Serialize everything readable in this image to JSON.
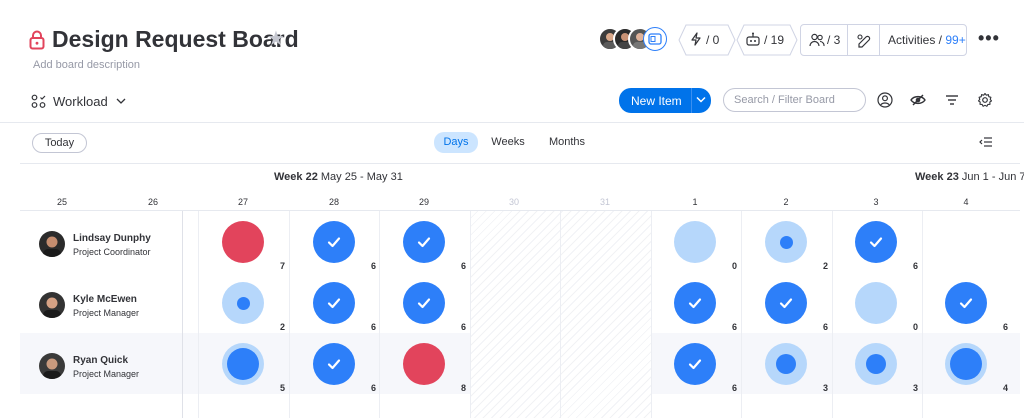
{
  "board": {
    "title": "Design Request Board",
    "description": "Add board description"
  },
  "header": {
    "updates_count": "/ 0",
    "robots_count": "/ 19",
    "members_count": "/ 3",
    "activities_label": "Activities /",
    "activities_count": "99+",
    "icons": [
      "lock-icon",
      "star-icon",
      "bolt-icon",
      "robot-icon",
      "people-icon",
      "integration-icon",
      "more-icon"
    ]
  },
  "toolbar": {
    "view_label": "Workload",
    "new_item_label": "New Item",
    "search_placeholder": "Search / Filter Board"
  },
  "range": {
    "today_label": "Today",
    "tabs": [
      {
        "label": "Days",
        "active": true
      },
      {
        "label": "Weeks",
        "active": false
      },
      {
        "label": "Months",
        "active": false
      }
    ]
  },
  "timeline": {
    "weeks": [
      {
        "name": "Week 22",
        "dates": "May 25 - May 31"
      },
      {
        "name": "Week 23",
        "dates": "Jun 1 - Jun 7"
      }
    ],
    "days": [
      {
        "label": "25",
        "weekend": false
      },
      {
        "label": "26",
        "weekend": false
      },
      {
        "label": "27",
        "weekend": false
      },
      {
        "label": "28",
        "weekend": false
      },
      {
        "label": "29",
        "weekend": false
      },
      {
        "label": "30",
        "weekend": true
      },
      {
        "label": "31",
        "weekend": true
      },
      {
        "label": "1",
        "weekend": false
      },
      {
        "label": "2",
        "weekend": false
      },
      {
        "label": "3",
        "weekend": false
      },
      {
        "label": "4",
        "weekend": false
      }
    ]
  },
  "people": [
    {
      "name": "Lindsay Dunphy",
      "role": "Project Coordinator",
      "cells": [
        {
          "day": "27",
          "style": "red",
          "count": "7"
        },
        {
          "day": "28",
          "style": "check",
          "count": "6"
        },
        {
          "day": "29",
          "style": "check",
          "count": "6"
        },
        {
          "day": "1",
          "style": "light",
          "count": "0"
        },
        {
          "day": "2",
          "style": "light-dot-small",
          "count": "2"
        },
        {
          "day": "3",
          "style": "check",
          "count": "6"
        }
      ]
    },
    {
      "name": "Kyle McEwen",
      "role": "Project Manager",
      "cells": [
        {
          "day": "27",
          "style": "light-dot-small",
          "count": "2"
        },
        {
          "day": "28",
          "style": "check",
          "count": "6"
        },
        {
          "day": "29",
          "style": "check",
          "count": "6"
        },
        {
          "day": "1",
          "style": "check",
          "count": "6"
        },
        {
          "day": "2",
          "style": "check",
          "count": "6"
        },
        {
          "day": "3",
          "style": "light",
          "count": "0"
        },
        {
          "day": "4",
          "style": "check",
          "count": "6"
        }
      ]
    },
    {
      "name": "Ryan Quick",
      "role": "Project Manager",
      "cells": [
        {
          "day": "27",
          "style": "light-dot-large",
          "count": "5"
        },
        {
          "day": "28",
          "style": "check",
          "count": "6"
        },
        {
          "day": "29",
          "style": "red",
          "count": "8"
        },
        {
          "day": "1",
          "style": "check",
          "count": "6"
        },
        {
          "day": "2",
          "style": "light-dot-medium",
          "count": "3"
        },
        {
          "day": "3",
          "style": "light-dot-medium",
          "count": "3"
        },
        {
          "day": "4",
          "style": "light-dot-large",
          "count": "4"
        }
      ]
    }
  ],
  "colors": {
    "overload": "#e2445c",
    "full": "#2d7ff9",
    "under": "#b6d7fb",
    "primary": "#0073ea"
  }
}
